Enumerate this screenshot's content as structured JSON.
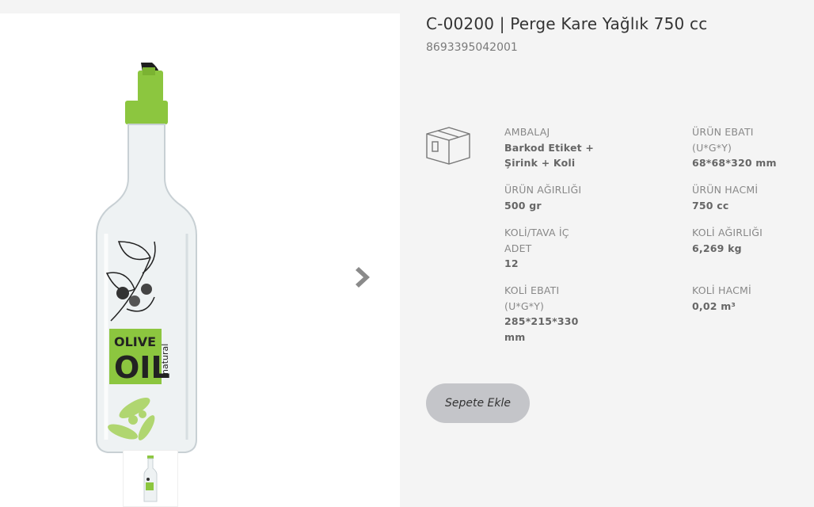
{
  "product": {
    "title": "C-00200 | Perge Kare Yağlık 750 cc",
    "barcode": "8693395042001"
  },
  "label_art": {
    "line1": "OLIVE",
    "line2": "OIL",
    "line3": "natural"
  },
  "specs": {
    "packaging": {
      "label": "AMBALAJ",
      "value": "Barkod Etiket + Şirink + Koli"
    },
    "product_dimensions": {
      "label": "ÜRÜN EBATI (U*G*Y)",
      "value": "68*68*320 mm"
    },
    "product_weight": {
      "label": "ÜRÜN AĞIRLIĞI",
      "value": "500 gr"
    },
    "product_volume": {
      "label": "ÜRÜN HACMİ",
      "value": "750 cc"
    },
    "units_per_box": {
      "label": "KOLİ/TAVA İÇ ADET",
      "value": "12"
    },
    "box_weight": {
      "label": "KOLİ AĞIRLIĞI",
      "value": "6,269 kg"
    },
    "box_dimensions": {
      "label": "KOLİ EBATI (U*G*Y)",
      "value": "285*215*330 mm"
    },
    "box_volume": {
      "label": "KOLİ HACMİ",
      "value": "0,02 m³"
    }
  },
  "actions": {
    "add_to_cart": "Sepete Ekle"
  },
  "icons": {
    "packaging": "box-icon",
    "next": "chevron-right-icon"
  },
  "colors": {
    "accent_green": "#8cc63f",
    "button_bg": "#c4c5c9",
    "panel_bg": "#f4f4f4"
  }
}
